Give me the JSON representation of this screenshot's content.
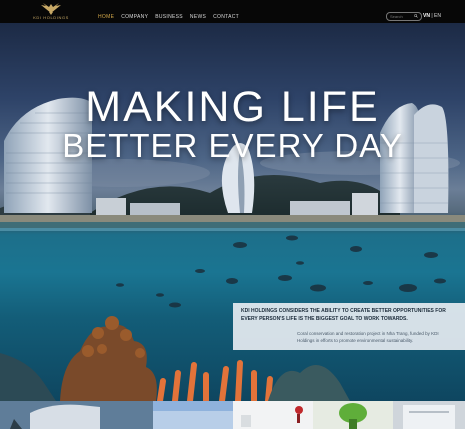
{
  "brand": {
    "name": "KDI HOLDINGS",
    "accent": "#d5a94a"
  },
  "nav": {
    "items": [
      "HOME",
      "COMPANY",
      "BUSINESS",
      "NEWS",
      "CONTACT"
    ],
    "active": "HOME"
  },
  "search": {
    "placeholder": "Search"
  },
  "language": {
    "items": [
      "VN",
      "EN"
    ],
    "active": "VN",
    "separator": "|"
  },
  "hero": {
    "headline_line1": "MAKING LIFE",
    "headline_line2": "BETTER EVERY DAY"
  },
  "info_box": {
    "title": "KDI HOLDINGS CONSIDERS THE ABILITY TO CREATE BETTER OPPORTUNITIES FOR EVERY PERSON'S LIFE IS THE BIGGEST GOAL TO WORK TOWARDS.",
    "description": "Coral conservation and restoration project in Nha Trang, funded by KDI Holdings in efforts to promote environmental sustainability."
  }
}
